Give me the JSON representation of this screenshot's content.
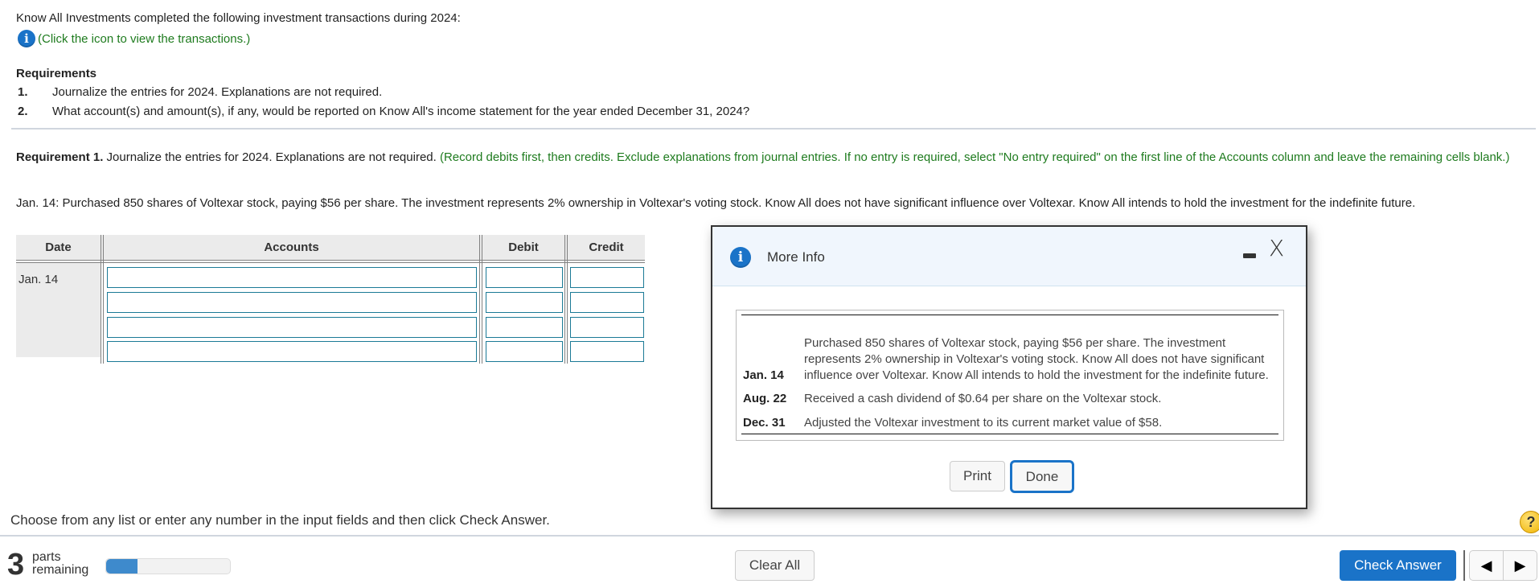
{
  "intro": {
    "text": "Know All Investments completed the following investment transactions during 2024:",
    "info_icon": "info-icon",
    "info_link": "(Click the icon to view the transactions.)"
  },
  "requirements": {
    "title": "Requirements",
    "items": [
      {
        "num": "1.",
        "text": "Journalize the entries for 2024. Explanations are not required."
      },
      {
        "num": "2.",
        "text": "What account(s) and amount(s), if any, would be reported on Know All's income statement for the year ended December 31, 2024?"
      }
    ]
  },
  "requirement1": {
    "label": "Requirement 1.",
    "text": " Journalize the entries for 2024. Explanations are not required. ",
    "instruction": "(Record debits first, then credits. Exclude explanations from journal entries. If no entry is required, select \"No entry required\" on the first line of the Accounts column and leave the remaining cells blank.)",
    "transaction": "Jan. 14: Purchased 850 shares of Voltexar stock, paying $56 per share. The investment represents 2% ownership in Voltexar's voting stock. Know All does not have significant influence over Voltexar. Know All intends to hold the investment for the indefinite future."
  },
  "journal": {
    "headers": {
      "date": "Date",
      "accounts": "Accounts",
      "debit": "Debit",
      "credit": "Credit"
    },
    "date": "Jan. 14",
    "rows": [
      {
        "account": "",
        "debit": "",
        "credit": ""
      },
      {
        "account": "",
        "debit": "",
        "credit": ""
      },
      {
        "account": "",
        "debit": "",
        "credit": ""
      },
      {
        "account": "",
        "debit": "",
        "credit": ""
      }
    ]
  },
  "modal": {
    "title": "More Info",
    "icon": "info-icon",
    "minimize_icon": "minimize-icon",
    "close_label": "X",
    "transactions": [
      {
        "date": "Jan. 14",
        "text": "Purchased 850 shares of Voltexar stock, paying $56 per share. The investment represents 2% ownership in Voltexar's voting stock. Know All does not have significant influence over Voltexar. Know All intends to hold the investment for the indefinite future."
      },
      {
        "date": "Aug. 22",
        "text": "Received a cash dividend of $0.64 per share on the Voltexar stock."
      },
      {
        "date": "Dec. 31",
        "text": "Adjusted the Voltexar investment to its current market value of $58."
      }
    ],
    "print_label": "Print",
    "done_label": "Done"
  },
  "footer": {
    "hint": "Choose from any list or enter any number in the input fields and then click Check Answer.",
    "help_label": "?",
    "parts_count": "3",
    "parts_label_1": "parts",
    "parts_label_2": "remaining",
    "progress_percent": 25,
    "clear_all_label": "Clear All",
    "check_answer_label": "Check Answer",
    "prev_icon": "◀",
    "next_icon": "▶"
  },
  "colors": {
    "accent_blue": "#1a73c8",
    "instruction_green": "#1e7b1e",
    "input_border": "#1b7a96"
  }
}
